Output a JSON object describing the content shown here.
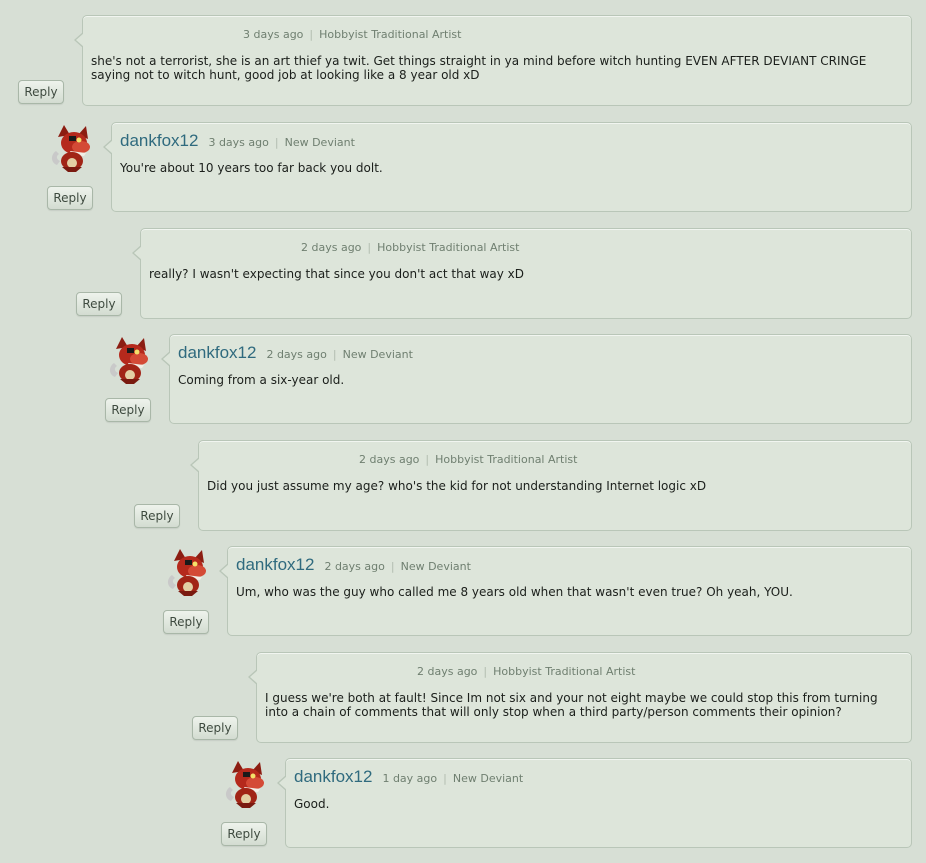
{
  "reply_label": "Reply",
  "separator": "|",
  "colors": {
    "background": "#d7dfd5",
    "bubble": "#dde5da",
    "username": "#2f6a7e",
    "meta": "#6f7f70"
  },
  "comments": [
    {
      "username": "",
      "time": "3 days ago",
      "role": "Hobbyist Traditional Artist",
      "text": "she's not a terrorist, she is an art thief ya twit. Get things straight in ya mind before witch hunting EVEN AFTER DEVIANT CRINGE saying not to witch hunt, good job at looking like a 8 year old xD"
    },
    {
      "username": "dankfox12",
      "time": "3 days ago",
      "role": "New Deviant",
      "text": "You're about 10 years too far back you dolt.",
      "avatar": "foxy-avatar-icon"
    },
    {
      "username": "",
      "time": "2 days ago",
      "role": "Hobbyist Traditional Artist",
      "text": "really? I wasn't expecting that since you don't act that way xD"
    },
    {
      "username": "dankfox12",
      "time": "2 days ago",
      "role": "New Deviant",
      "text": "Coming from a six-year old.",
      "avatar": "foxy-avatar-icon"
    },
    {
      "username": "",
      "time": "2 days ago",
      "role": "Hobbyist Traditional Artist",
      "text": "Did you just assume my age? who's the kid for not understanding Internet logic xD"
    },
    {
      "username": "dankfox12",
      "time": "2 days ago",
      "role": "New Deviant",
      "text": "Um, who was the guy who called me 8 years old when that wasn't even true? Oh yeah, YOU.",
      "avatar": "foxy-avatar-icon"
    },
    {
      "username": "",
      "time": "2 days ago",
      "role": "Hobbyist Traditional Artist",
      "text": "I guess we're both at fault! Since Im not six and your not eight maybe we could stop this from turning into a chain of comments that will only stop when a third party/person comments their opinion?"
    },
    {
      "username": "dankfox12",
      "time": "1 day ago",
      "role": "New Deviant",
      "text": "Good.",
      "avatar": "foxy-avatar-icon"
    }
  ]
}
